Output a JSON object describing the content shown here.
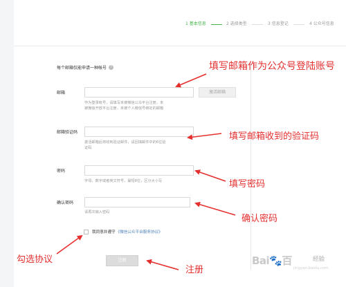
{
  "steps": [
    "1 基本信息",
    "2 选择类型",
    "3 信息登记",
    "4 公众号信息"
  ],
  "form": {
    "title": "每个邮箱仅能申请一种帐号",
    "email_label": "邮箱",
    "email_value": "",
    "email_hint": "作为登录帐号，请填写未被微信公众平台注册，未\n被微信开放平台注册，未被个人微信号绑定的邮箱",
    "activate_label": "激活邮箱",
    "code_label": "邮箱验证码",
    "code_value": "",
    "code_hint": "激活邮箱后将收到验证邮件，请回填邮件中的6位验\n证码",
    "password_label": "密码",
    "password_value": "",
    "password_hint": "字母、数字或者英文符号，最短8位，区分大小写",
    "confirm_label": "确认密码",
    "confirm_value": "",
    "confirm_hint": "请再次输入密码",
    "agree_prefix": "我同意并遵守",
    "agree_link": "《微信公众平台服务协议》",
    "register_label": "注册"
  },
  "annotations": {
    "email": "填写邮箱作为公众号登陆账号",
    "code": "填写邮箱收到的验证码",
    "password": "填写密码",
    "confirm": "确认密码",
    "agree": "勾选协议",
    "register": "注册"
  },
  "watermark": {
    "logo": "Bai",
    "logo_paw": "🐾",
    "logo_tail": "百",
    "text": "经验",
    "url": "jingyan.baidu.com"
  },
  "colors": {
    "accent": "#44b549",
    "annotation": "#e52f2f",
    "link": "#4a7fb5"
  }
}
